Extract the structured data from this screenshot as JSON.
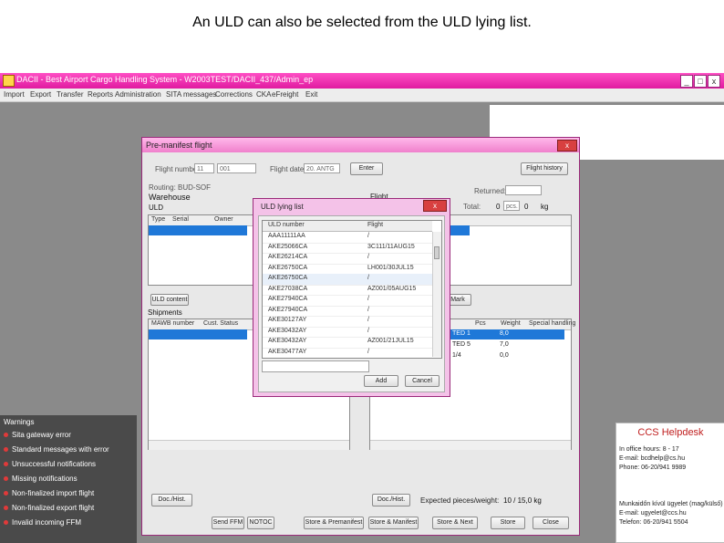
{
  "slide": {
    "title": "An ULD can also be selected from the ULD lying list."
  },
  "app": {
    "window_title": "DACII - Best Airport Cargo Handling System - W2003TEST/DACII_437/Admin_ep",
    "minimize": "_",
    "maximize": "□",
    "close": "x",
    "menu": [
      "Import",
      "Export",
      "Transfer",
      "Reports",
      "Administration",
      "SITA messages",
      "Corrections",
      "CKA",
      "eFreight",
      "Exit"
    ]
  },
  "warnings": {
    "title": "Warnings",
    "items": [
      "Sita gateway error",
      "Standard messages with error",
      "Unsuccessful notifications",
      "Missing notifications",
      "Non-finalized import flight",
      "Non-finalized export flight",
      "Invalid incoming FFM"
    ]
  },
  "helpdesk": {
    "title": "CCS Helpdesk",
    "lines": [
      "In office hours: 8 - 17",
      "E-mail: bcdhelp@cs.hu",
      "Phone: 06-20/941 9989",
      "",
      "Munkaidőn kívül ügyelet (mag/külső)",
      "E-mail: ugyelet@ccs.hu",
      "Telefon: 06-20/941 5504"
    ],
    "title_color": "#c02020"
  },
  "pmf": {
    "title": "Pre-manifest flight",
    "close": "x",
    "flight_number_label": "Flight number:",
    "flight_number_prefix": "11",
    "flight_number_value": "001",
    "flight_date_label": "Flight date:",
    "flight_date_value": "20. ANTG",
    "enter_button": "Enter",
    "flight_history_button": "Flight history",
    "routing_label": "Routing: BUD-SOF",
    "warehouse_label": "Warehouse",
    "uld_label": "ULD",
    "uld_columns": [
      "Type",
      "Serial",
      "Owner"
    ],
    "flight_label": "Flight",
    "returned_label": "Returned:",
    "total_label": "Total:",
    "total_value": "0",
    "total_unit": "pcs.",
    "total_kg_value": "0",
    "total_kg_unit": "kg",
    "uld_content_button": "ULD content",
    "mark_button": "Mark",
    "shipments_label": "Shipments",
    "shipment_columns": [
      "MAWB number",
      "Cust. Status"
    ],
    "right_columns": [
      "Pcs",
      "Weight",
      "Special handling"
    ],
    "right_rows": [
      {
        "status": "TED 1",
        "weight": "8,0",
        "selected": true
      },
      {
        "status": "TED 5",
        "weight": "7,0",
        "selected": false
      },
      {
        "status": "1/4",
        "weight": "0,0",
        "selected": false
      }
    ],
    "doc_hist_left": "Doc./Hist.",
    "doc_hist_right": "Doc./Hist.",
    "expected_label": "Expected pieces/weight:",
    "expected_value": "10 / 15,0 kg",
    "bottom_buttons": [
      "Send FFM",
      "NOTOC",
      "Store & Premanifest",
      "Store & Manifest",
      "Store & Next",
      "Store",
      "Close"
    ]
  },
  "uld_dialog": {
    "title": "ULD lying list",
    "close": "x",
    "columns": [
      "ULD number",
      "Flight"
    ],
    "rows": [
      {
        "uld": "AAA11111AA",
        "flight": "/"
      },
      {
        "uld": "AKE25066CA",
        "flight": "3C111/11AUG15"
      },
      {
        "uld": "AKE26214CA",
        "flight": "/"
      },
      {
        "uld": "AKE26750CA",
        "flight": "LH001/30JUL15"
      },
      {
        "uld": "AKE26750CA",
        "flight": "/"
      },
      {
        "uld": "AKE27038CA",
        "flight": "AZ001/05AUG15"
      },
      {
        "uld": "AKE27940CA",
        "flight": "/"
      },
      {
        "uld": "AKE27940CA",
        "flight": "/"
      },
      {
        "uld": "AKE30127AY",
        "flight": "/"
      },
      {
        "uld": "AKE30432AY",
        "flight": "/"
      },
      {
        "uld": "AKE30432AY",
        "flight": "AZ001/21JUL15"
      },
      {
        "uld": "AKE30477AY",
        "flight": "/"
      }
    ],
    "search_value": "",
    "add_button": "Add",
    "cancel_button": "Cancel"
  }
}
